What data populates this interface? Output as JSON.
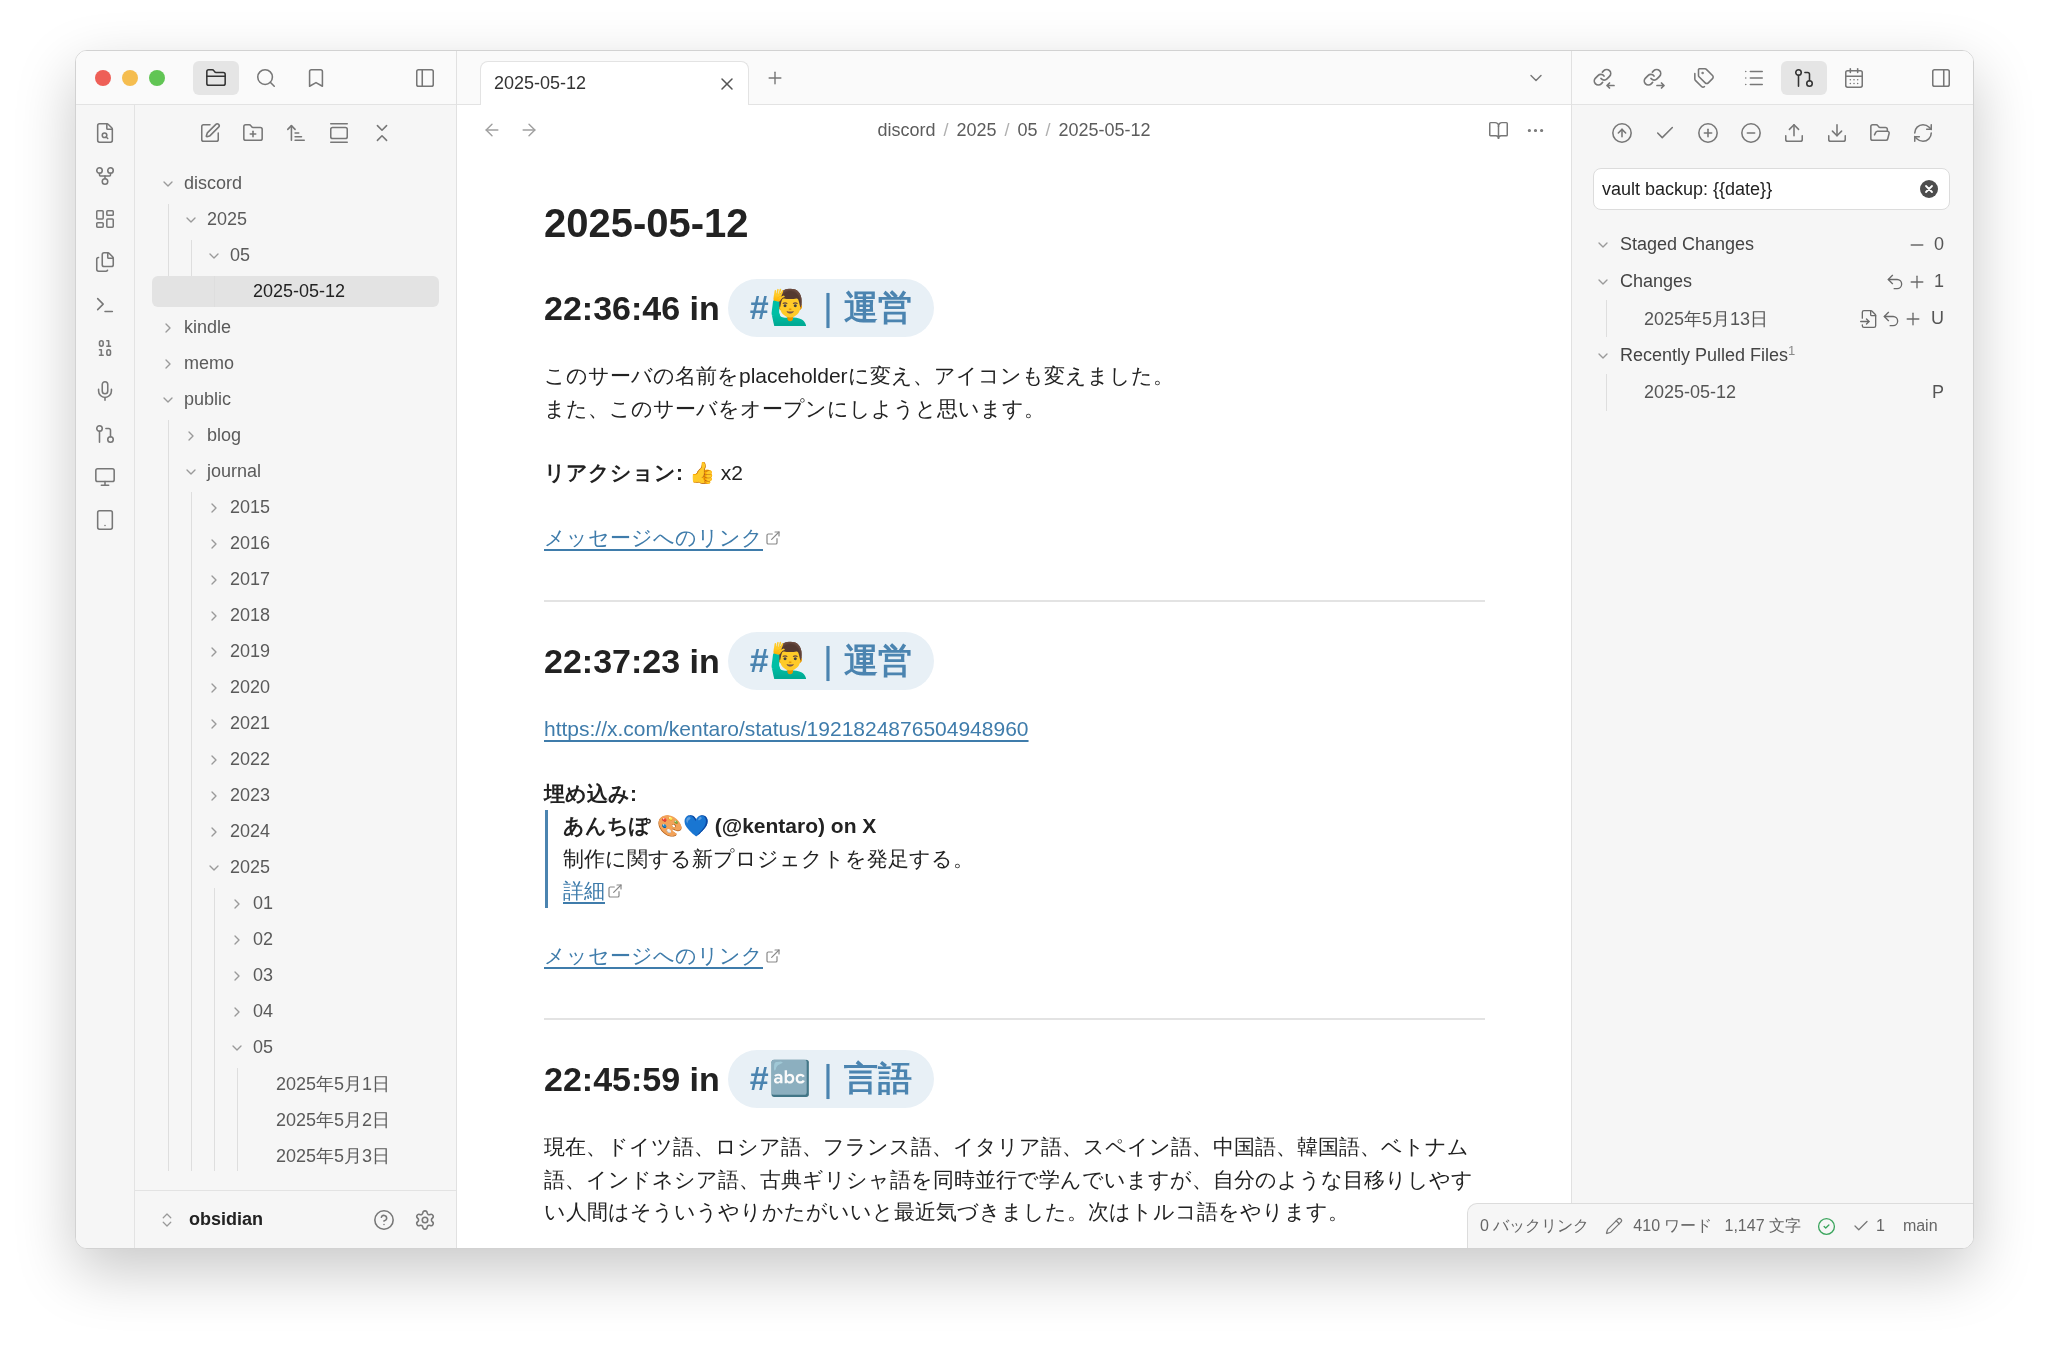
{
  "left_header": {
    "view_tabs": [
      {
        "kind": "files",
        "selected": true
      },
      {
        "kind": "search",
        "selected": false
      },
      {
        "kind": "bookmarks",
        "selected": false
      }
    ]
  },
  "file_tree": {
    "items": [
      {
        "kind": "folder",
        "label": "discord",
        "expanded": true,
        "selected": false,
        "children": [
          {
            "kind": "folder",
            "label": "2025",
            "expanded": true,
            "selected": false,
            "children": [
              {
                "kind": "folder",
                "label": "05",
                "expanded": true,
                "selected": false,
                "children": [
                  {
                    "kind": "file",
                    "label": "2025-05-12",
                    "selected": true
                  }
                ]
              }
            ]
          }
        ]
      },
      {
        "kind": "folder",
        "label": "kindle",
        "expanded": false,
        "selected": false
      },
      {
        "kind": "folder",
        "label": "memo",
        "expanded": false,
        "selected": false
      },
      {
        "kind": "folder",
        "label": "public",
        "expanded": true,
        "selected": false,
        "children": [
          {
            "kind": "folder",
            "label": "blog",
            "expanded": false,
            "selected": false
          },
          {
            "kind": "folder",
            "label": "journal",
            "expanded": true,
            "selected": false,
            "children": [
              {
                "kind": "folder",
                "label": "2015",
                "expanded": false,
                "selected": false
              },
              {
                "kind": "folder",
                "label": "2016",
                "expanded": false,
                "selected": false
              },
              {
                "kind": "folder",
                "label": "2017",
                "expanded": false,
                "selected": false
              },
              {
                "kind": "folder",
                "label": "2018",
                "expanded": false,
                "selected": false
              },
              {
                "kind": "folder",
                "label": "2019",
                "expanded": false,
                "selected": false
              },
              {
                "kind": "folder",
                "label": "2020",
                "expanded": false,
                "selected": false
              },
              {
                "kind": "folder",
                "label": "2021",
                "expanded": false,
                "selected": false
              },
              {
                "kind": "folder",
                "label": "2022",
                "expanded": false,
                "selected": false
              },
              {
                "kind": "folder",
                "label": "2023",
                "expanded": false,
                "selected": false
              },
              {
                "kind": "folder",
                "label": "2024",
                "expanded": false,
                "selected": false
              },
              {
                "kind": "folder",
                "label": "2025",
                "expanded": true,
                "selected": false,
                "children": [
                  {
                    "kind": "folder",
                    "label": "01",
                    "expanded": false,
                    "selected": false
                  },
                  {
                    "kind": "folder",
                    "label": "02",
                    "expanded": false,
                    "selected": false
                  },
                  {
                    "kind": "folder",
                    "label": "03",
                    "expanded": false,
                    "selected": false
                  },
                  {
                    "kind": "folder",
                    "label": "04",
                    "expanded": false,
                    "selected": false
                  },
                  {
                    "kind": "folder",
                    "label": "05",
                    "expanded": true,
                    "selected": false,
                    "children": [
                      {
                        "kind": "file",
                        "label": "2025年5月1日",
                        "selected": false
                      },
                      {
                        "kind": "file",
                        "label": "2025年5月2日",
                        "selected": false
                      },
                      {
                        "kind": "file",
                        "label": "2025年5月3日",
                        "selected": false
                      }
                    ]
                  }
                ]
              }
            ]
          }
        ]
      }
    ]
  },
  "vault": {
    "name": "obsidian"
  },
  "tabs": [
    {
      "title": "2025-05-12",
      "selected": true
    }
  ],
  "breadcrumb": [
    {
      "kind": "segment",
      "text": "discord"
    },
    {
      "kind": "separator",
      "text": "/"
    },
    {
      "kind": "segment",
      "text": "2025"
    },
    {
      "kind": "separator",
      "text": "/"
    },
    {
      "kind": "segment",
      "text": "05"
    },
    {
      "kind": "separator",
      "text": "/"
    },
    {
      "kind": "segment",
      "text": "2025-05-12"
    }
  ],
  "note": {
    "title": "2025-05-12",
    "sections": [
      {
        "heading": "22:36:46 in",
        "tag": "#🙋‍♂️｜運営",
        "blocks": [
          {
            "kind": "paragraph",
            "lines": [
              "このサーバの名前をplaceholderに変え、アイコンも変えました。",
              "また、このサーバをオープンにしようと思います。"
            ]
          },
          {
            "kind": "paragraph",
            "lines": [
              "**リアクション:** 👍 x2"
            ]
          },
          {
            "kind": "link",
            "text": "メッセージへのリンク"
          }
        ]
      },
      {
        "heading": "22:37:23 in",
        "tag": "#🙋‍♂️｜運営",
        "blocks": [
          {
            "kind": "url",
            "text": "https://x.com/kentaro/status/1921824876504948960"
          },
          {
            "kind": "embed",
            "label": "埋め込み:",
            "title": "あんちぽ 🎨💙 (@kentaro) on X",
            "description": "制作に関する新プロジェクトを発足する。",
            "link": "詳細"
          },
          {
            "kind": "link",
            "text": "メッセージへのリンク"
          }
        ]
      },
      {
        "heading": "22:45:59 in",
        "tag": "#🔤｜言語",
        "blocks": [
          {
            "kind": "paragraph",
            "lines": [
              "現在、ドイツ語、ロシア語、フランス語、イタリア語、スペイン語、中国語、韓国語、ベトナム語、インドネシア語、古典ギリシャ語を同時並行で学んでいますが、自分のような目移りしやすい人間はそういうやりかたがいいと最近気づきました。次はトルコ語をやります。"
            ]
          }
        ]
      }
    ]
  },
  "right_header": {
    "view_tabs": [
      {
        "kind": "backlinks",
        "selected": false
      },
      {
        "kind": "outgoing-links",
        "selected": false
      },
      {
        "kind": "tags",
        "selected": false
      },
      {
        "kind": "outline",
        "selected": false
      },
      {
        "kind": "git",
        "selected": true
      },
      {
        "kind": "calendar",
        "selected": false
      }
    ]
  },
  "git": {
    "commit_message": "vault backup: {{date}}",
    "groups": [
      {
        "kind": "staged",
        "label": "Staged Changes",
        "expanded": true,
        "count": "0"
      },
      {
        "kind": "changes",
        "label": "Changes",
        "expanded": true,
        "count": "1",
        "files": [
          {
            "name": "2025年5月13日",
            "status": "U"
          }
        ]
      },
      {
        "kind": "pulled",
        "label": "Recently Pulled Files",
        "expanded": true,
        "count": "1",
        "files": [
          {
            "name": "2025-05-12",
            "status": "P"
          }
        ]
      }
    ]
  },
  "status_bar": {
    "backlinks": "0 バックリンク",
    "words": "410 ワード",
    "characters": "1,147 文字",
    "commits": "1",
    "branch": "main"
  }
}
